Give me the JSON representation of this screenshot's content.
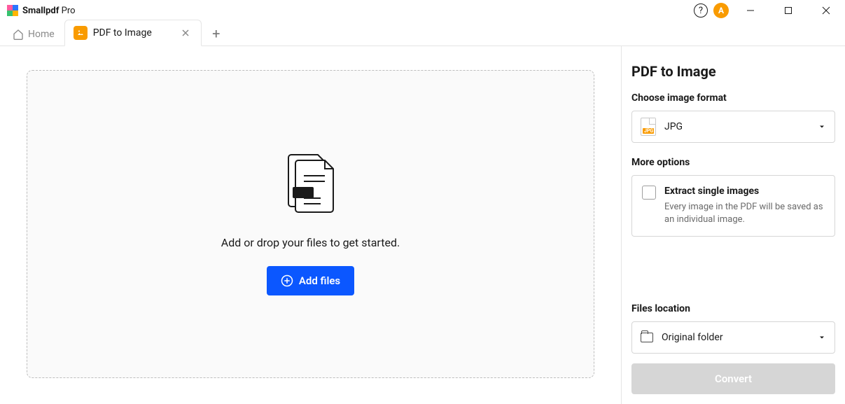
{
  "app": {
    "name_bold": "Smallpdf",
    "name_light": " Pro"
  },
  "avatar_letter": "A",
  "tabs": {
    "home_label": "Home",
    "active": {
      "label": "PDF to Image"
    }
  },
  "dropzone": {
    "message": "Add or drop your files to get started.",
    "add_button": "Add files"
  },
  "sidebar": {
    "title": "PDF to Image",
    "format_label": "Choose image format",
    "format_value": "JPG",
    "format_icon_tag": "JPG",
    "more_options_label": "More options",
    "option": {
      "title": "Extract single images",
      "desc": "Every image in the PDF will be saved as an individual image."
    },
    "location_label": "Files location",
    "location_value": "Original folder",
    "convert_button": "Convert"
  }
}
